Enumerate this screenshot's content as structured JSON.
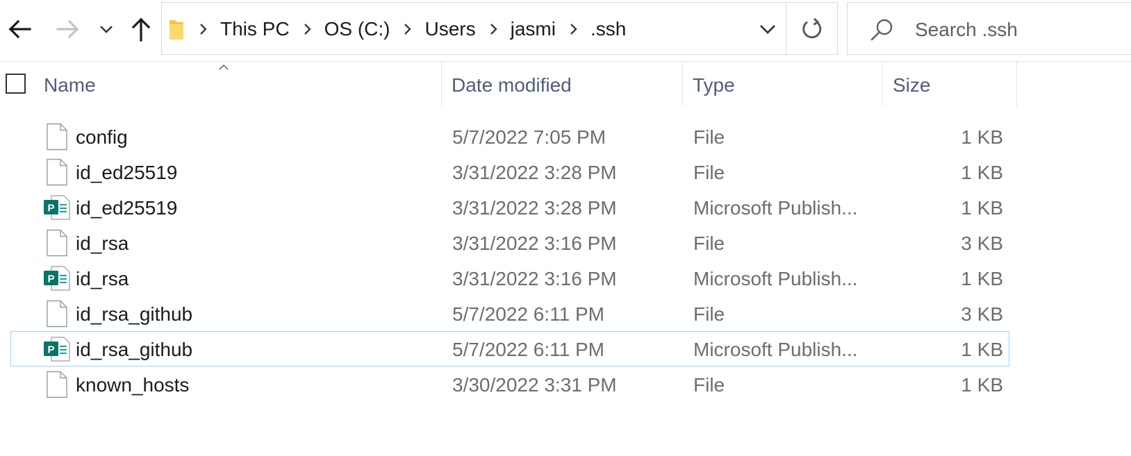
{
  "breadcrumb": [
    "This PC",
    "OS (C:)",
    "Users",
    "jasmi",
    ".ssh"
  ],
  "search": {
    "placeholder": "Search .ssh"
  },
  "columns": {
    "name": "Name",
    "date": "Date modified",
    "type": "Type",
    "size": "Size"
  },
  "files": [
    {
      "name": "config",
      "date": "5/7/2022 7:05 PM",
      "type": "File",
      "size": "1 KB",
      "icon": "generic-file-icon"
    },
    {
      "name": "id_ed25519",
      "date": "3/31/2022 3:28 PM",
      "type": "File",
      "size": "1 KB",
      "icon": "generic-file-icon"
    },
    {
      "name": "id_ed25519",
      "date": "3/31/2022 3:28 PM",
      "type": "Microsoft Publish...",
      "size": "1 KB",
      "icon": "publisher-file-icon"
    },
    {
      "name": "id_rsa",
      "date": "3/31/2022 3:16 PM",
      "type": "File",
      "size": "3 KB",
      "icon": "generic-file-icon"
    },
    {
      "name": "id_rsa",
      "date": "3/31/2022 3:16 PM",
      "type": "Microsoft Publish...",
      "size": "1 KB",
      "icon": "publisher-file-icon"
    },
    {
      "name": "id_rsa_github",
      "date": "5/7/2022 6:11 PM",
      "type": "File",
      "size": "3 KB",
      "icon": "generic-file-icon"
    },
    {
      "name": "id_rsa_github",
      "date": "5/7/2022 6:11 PM",
      "type": "Microsoft Publish...",
      "size": "1 KB",
      "icon": "publisher-file-icon",
      "focused": true
    },
    {
      "name": "known_hosts",
      "date": "3/30/2022 3:31 PM",
      "type": "File",
      "size": "1 KB",
      "icon": "generic-file-icon"
    }
  ],
  "colors": {
    "focus_border": "#99d1ff",
    "publisher_icon": "#077568",
    "header_text": "#4c607a"
  }
}
